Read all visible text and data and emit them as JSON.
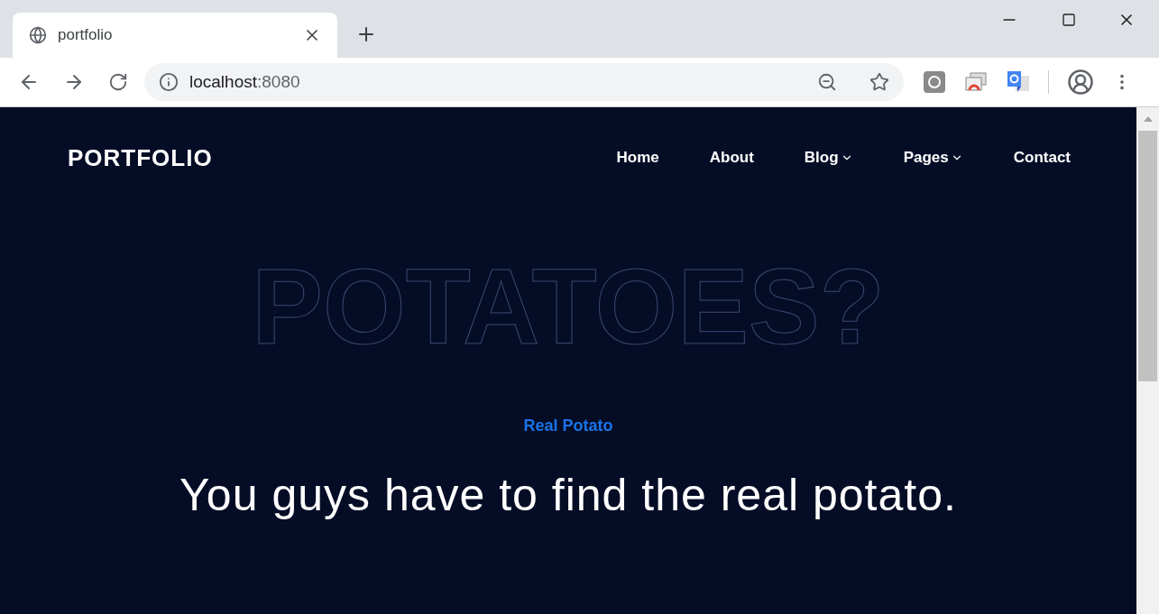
{
  "browser": {
    "tab": {
      "title": "portfolio",
      "selected": true
    },
    "address": {
      "host": "localhost",
      "port": ":8080"
    }
  },
  "page": {
    "brand": "PORTFOLIO",
    "nav": [
      {
        "label": "Home",
        "dropdown": false
      },
      {
        "label": "About",
        "dropdown": false
      },
      {
        "label": "Blog",
        "dropdown": true
      },
      {
        "label": "Pages",
        "dropdown": true
      },
      {
        "label": "Contact",
        "dropdown": false
      }
    ],
    "backdrop_text": "POTATOES?",
    "eyebrow": "Real Potato",
    "headline": "You guys have to find the real potato."
  }
}
